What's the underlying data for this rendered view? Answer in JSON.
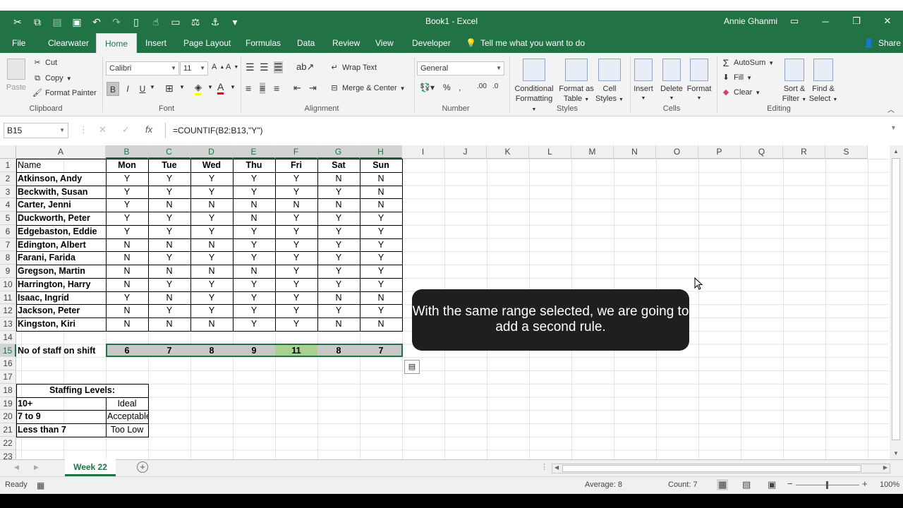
{
  "window": {
    "title": "Book1 - Excel",
    "user": "Annie Ghanmi",
    "accent": "#217346"
  },
  "qat": {
    "cut_icon": "scissors-icon",
    "save_icon": "save-icon",
    "undo_icon": "undo-icon",
    "redo_icon": "redo-icon"
  },
  "tabs": [
    "File",
    "Clearwater",
    "Home",
    "Insert",
    "Page Layout",
    "Formulas",
    "Data",
    "Review",
    "View",
    "Developer"
  ],
  "tell_me": "Tell me what you want to do",
  "share": "Share",
  "ribbon": {
    "clipboard": {
      "paste": "Paste",
      "cut": "Cut",
      "copy": "Copy",
      "format_painter": "Format Painter",
      "label": "Clipboard"
    },
    "font": {
      "name": "Calibri",
      "size": "11",
      "label": "Font",
      "bold": "B",
      "italic": "I",
      "underline": "U"
    },
    "alignment": {
      "wrap": "Wrap Text",
      "merge": "Merge & Center",
      "label": "Alignment"
    },
    "number": {
      "format": "General",
      "label": "Number"
    },
    "styles": {
      "conditional": "Conditional",
      "conditional2": "Formatting",
      "format_as": "Format as",
      "format_as2": "Table",
      "cell": "Cell",
      "cell2": "Styles",
      "label": "Styles"
    },
    "cells": {
      "insert": "Insert",
      "delete": "Delete",
      "format": "Format",
      "label": "Cells"
    },
    "editing": {
      "autosum": "AutoSum",
      "fill": "Fill",
      "clear": "Clear",
      "sort": "Sort &",
      "sort2": "Filter",
      "find": "Find &",
      "find2": "Select",
      "label": "Editing"
    }
  },
  "formula_bar": {
    "name_box": "B15",
    "fx": "fx",
    "formula": "=COUNTIF(B2:B13,\"Y\")"
  },
  "columns": [
    "A",
    "B",
    "C",
    "D",
    "E",
    "F",
    "G",
    "H",
    "I",
    "J",
    "K",
    "L",
    "M",
    "N",
    "O",
    "P",
    "Q",
    "R",
    "S"
  ],
  "rows": [
    "1",
    "2",
    "3",
    "4",
    "5",
    "6",
    "7",
    "8",
    "9",
    "10",
    "11",
    "12",
    "13",
    "14",
    "15",
    "16",
    "17",
    "18",
    "19",
    "20",
    "21",
    "22",
    "23"
  ],
  "sheet": {
    "header": [
      "Name",
      "Mon",
      "Tue",
      "Wed",
      "Thu",
      "Fri",
      "Sat",
      "Sun"
    ],
    "staff": [
      [
        "Atkinson, Andy",
        "Y",
        "Y",
        "Y",
        "Y",
        "Y",
        "N",
        "N"
      ],
      [
        "Beckwith, Susan",
        "Y",
        "Y",
        "Y",
        "Y",
        "Y",
        "Y",
        "N"
      ],
      [
        "Carter, Jenni",
        "Y",
        "N",
        "N",
        "N",
        "N",
        "N",
        "N"
      ],
      [
        "Duckworth, Peter",
        "Y",
        "Y",
        "Y",
        "N",
        "Y",
        "Y",
        "Y"
      ],
      [
        "Edgebaston, Eddie",
        "Y",
        "Y",
        "Y",
        "Y",
        "Y",
        "Y",
        "Y"
      ],
      [
        "Edington, Albert",
        "N",
        "N",
        "N",
        "Y",
        "Y",
        "Y",
        "Y"
      ],
      [
        "Farani, Farida",
        "N",
        "Y",
        "Y",
        "Y",
        "Y",
        "Y",
        "Y"
      ],
      [
        "Gregson, Martin",
        "N",
        "N",
        "N",
        "N",
        "Y",
        "Y",
        "Y"
      ],
      [
        "Harrington, Harry",
        "N",
        "Y",
        "Y",
        "Y",
        "Y",
        "Y",
        "Y"
      ],
      [
        "Isaac, Ingrid",
        "Y",
        "N",
        "Y",
        "Y",
        "Y",
        "N",
        "N"
      ],
      [
        "Jackson, Peter",
        "N",
        "Y",
        "Y",
        "Y",
        "Y",
        "Y",
        "Y"
      ],
      [
        "Kingston, Kiri",
        "N",
        "N",
        "N",
        "Y",
        "Y",
        "N",
        "N"
      ]
    ],
    "totals_label": "No of staff on shift",
    "totals": [
      "6",
      "7",
      "8",
      "9",
      "11",
      "8",
      "7"
    ],
    "levels_title": "Staffing Levels:",
    "levels": [
      [
        "10+",
        "Ideal"
      ],
      [
        "7 to 9",
        "Acceptable"
      ],
      [
        "Less than 7",
        "Too Low"
      ]
    ]
  },
  "caption": "With the same range selected, we are going to add a second rule.",
  "sheet_tab": "Week 22",
  "status": {
    "ready": "Ready",
    "average": "Average: 8",
    "count": "Count: 7",
    "zoom": "100%"
  }
}
